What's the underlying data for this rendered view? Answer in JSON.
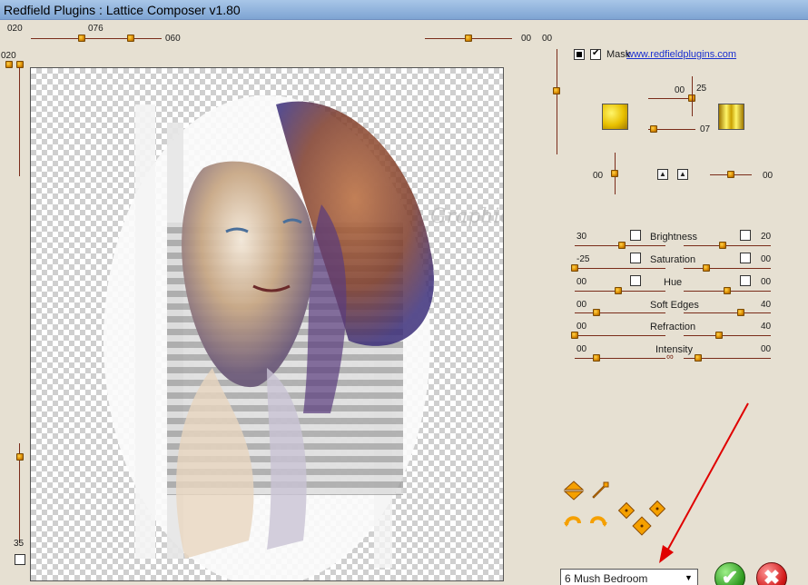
{
  "window": {
    "title": "Redfield Plugins : Lattice Composer v1.80"
  },
  "top_controls": {
    "left_label": "020",
    "slider_a_label": "076",
    "slider_b_label": "060",
    "right_val_1": "00",
    "right_val_2": "00"
  },
  "left_controls": {
    "top_label": "020",
    "bottom_label": "35"
  },
  "website_link": "www.redfieldplugins.com",
  "mask": {
    "label": "Mask",
    "checked": true
  },
  "tile_controls": {
    "val_top": "00",
    "val_25": "25",
    "val_07": "07"
  },
  "offset_controls": {
    "left_val": "00",
    "right_val": "00"
  },
  "adjustments": [
    {
      "name": "Brightness",
      "left": "30",
      "right": "20"
    },
    {
      "name": "Saturation",
      "left": "-25",
      "right": "00"
    },
    {
      "name": "Hue",
      "left": "00",
      "right": "00"
    },
    {
      "name": "Soft Edges",
      "left": "00",
      "right": "40"
    },
    {
      "name": "Refraction",
      "left": "00",
      "right": "40"
    },
    {
      "name": "Intensity",
      "left": "00",
      "right": "00"
    }
  ],
  "preset": {
    "selected": "6 Mush Bedroom"
  },
  "colors": {
    "accent_knob": "#f0a000",
    "track": "#7a2c1a",
    "bg": "#e6e0d2",
    "link": "#1a2fd0"
  }
}
